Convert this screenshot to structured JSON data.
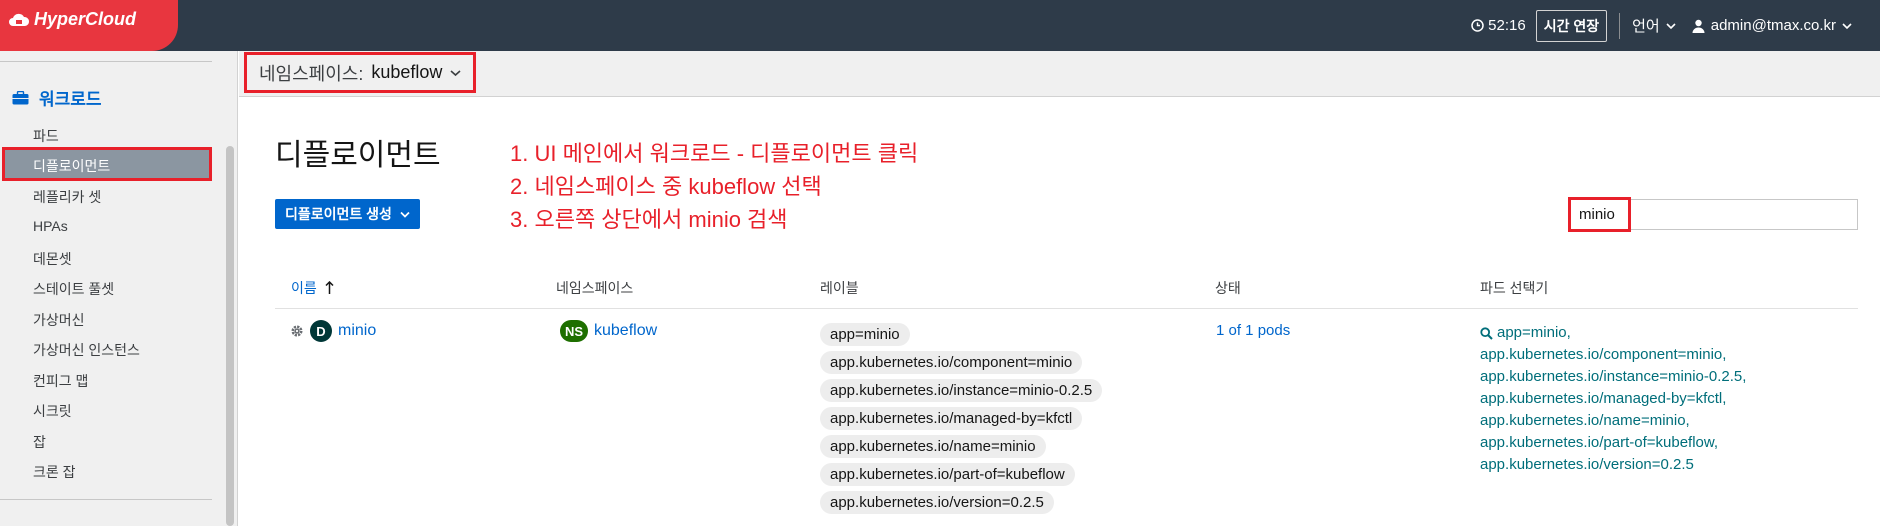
{
  "brand": {
    "name": "HyperCloud",
    "color": "#e8363f"
  },
  "header": {
    "timer": "52:16",
    "extend_label": "시간 연장",
    "language_label": "언어",
    "user": "admin@tmax.co.kr"
  },
  "sidebar": {
    "section_title": "워크로드",
    "items": [
      {
        "label": "파드"
      },
      {
        "label": "디플로이먼트",
        "active": true
      },
      {
        "label": "레플리카 셋"
      },
      {
        "label": "HPAs"
      },
      {
        "label": "데몬셋"
      },
      {
        "label": "스테이트 풀셋"
      },
      {
        "label": "가상머신"
      },
      {
        "label": "가상머신 인스턴스"
      },
      {
        "label": "컨피그 맵"
      },
      {
        "label": "시크릿"
      },
      {
        "label": "잡"
      },
      {
        "label": "크론 잡"
      }
    ]
  },
  "namespace_bar": {
    "label": "네임스페이스:",
    "value": "kubeflow"
  },
  "page": {
    "title": "디플로이먼트",
    "create_button": "디플로이먼트 생성",
    "search_value": "minio"
  },
  "annotations": [
    "1. UI 메인에서 워크로드 - 디플로이먼트 클릭",
    "2. 네임스페이스 중 kubeflow 선택",
    "3. 오른쪽 상단에서 minio 검색"
  ],
  "table": {
    "columns": [
      "이름",
      "네임스페이스",
      "레이블",
      "상태",
      "파드 선택기"
    ],
    "rows": [
      {
        "name_badge": "D",
        "name": "minio",
        "ns_badge": "NS",
        "namespace": "kubeflow",
        "labels": [
          "app=minio",
          "app.kubernetes.io/component=minio",
          "app.kubernetes.io/instance=minio-0.2.5",
          "app.kubernetes.io/managed-by=kfctl",
          "app.kubernetes.io/name=minio",
          "app.kubernetes.io/part-of=kubeflow",
          "app.kubernetes.io/version=0.2.5"
        ],
        "status": "1 of 1 pods",
        "selector": [
          "app=minio,",
          "app.kubernetes.io/component=minio,",
          "app.kubernetes.io/instance=minio-0.2.5,",
          "app.kubernetes.io/managed-by=kfctl,",
          "app.kubernetes.io/name=minio,",
          "app.kubernetes.io/part-of=kubeflow,",
          "app.kubernetes.io/version=0.2.5"
        ]
      }
    ]
  },
  "colors": {
    "accent": "#0066cc",
    "highlight": "#e8202a",
    "masthead": "#2e3b49"
  }
}
